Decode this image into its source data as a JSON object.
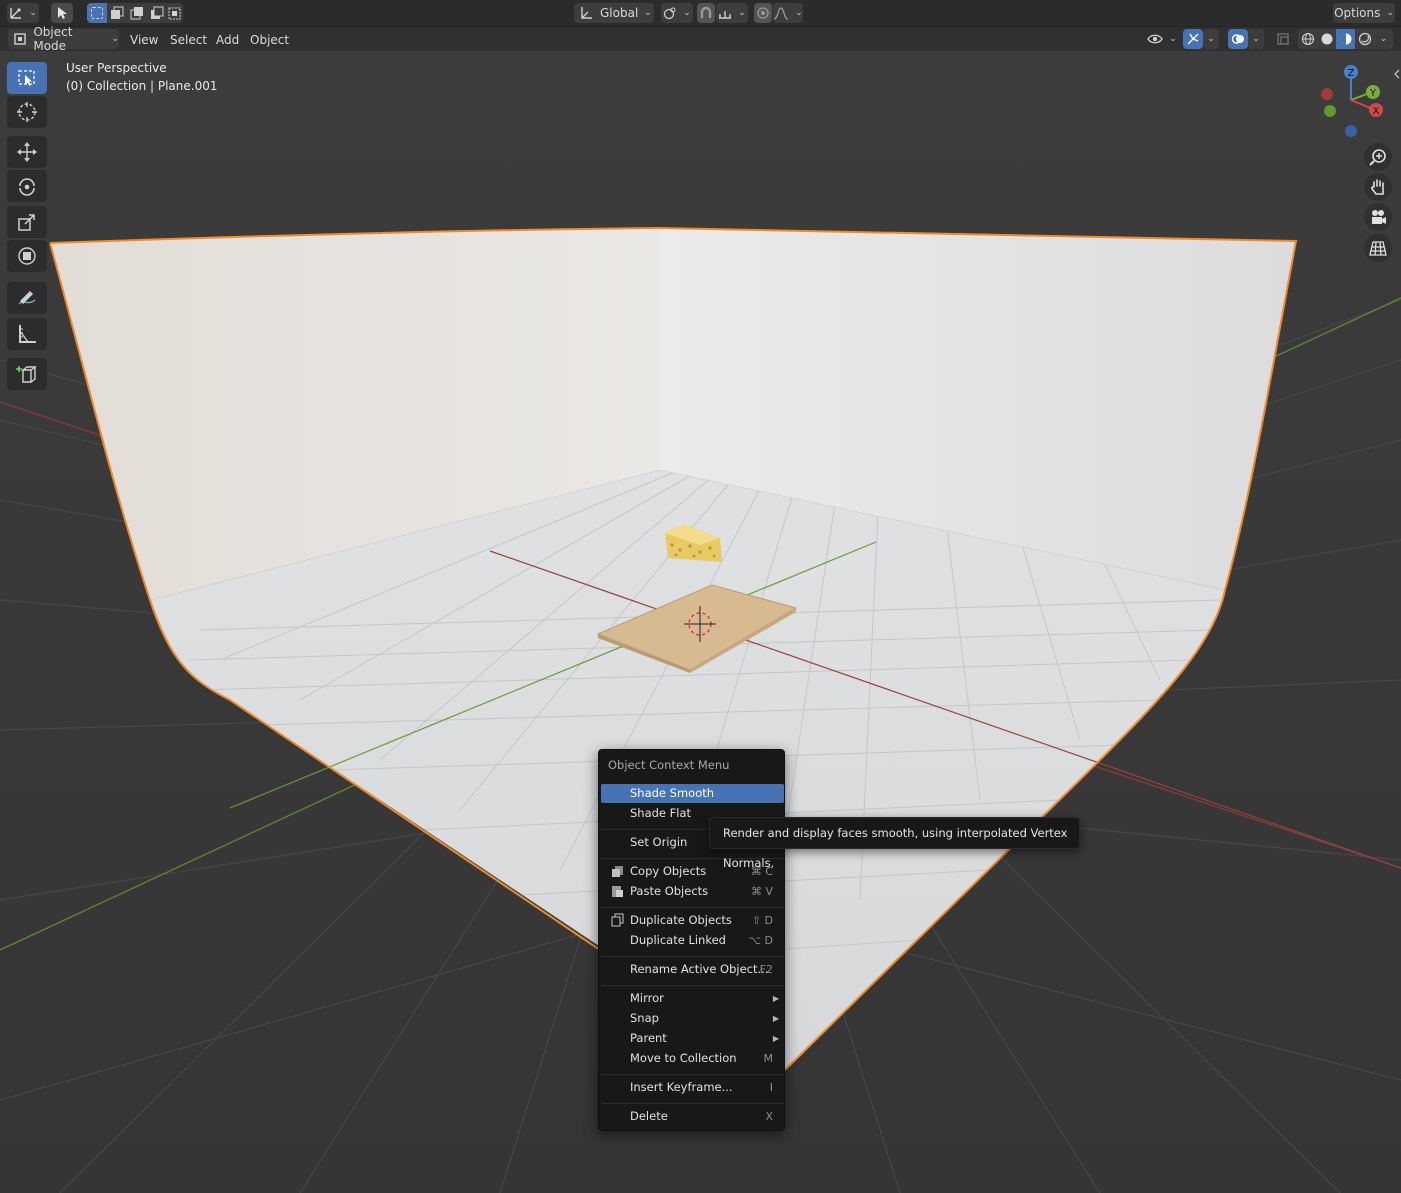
{
  "header": {
    "options_label": "Options",
    "transform_orientation": "Global",
    "mode_label": "Object Mode",
    "menus": [
      "View",
      "Select",
      "Add",
      "Object"
    ]
  },
  "viewport": {
    "view_name": "User Perspective",
    "collection_info": "(0) Collection | Plane.001",
    "gizmo": {
      "x": "X",
      "y": "Y",
      "z": "Z"
    }
  },
  "context_menu": {
    "title": "Object Context Menu",
    "items": [
      {
        "label": "Shade Smooth",
        "shortcut": ""
      },
      {
        "label": "Shade Flat",
        "shortcut": ""
      },
      {
        "label": "Set Origin",
        "shortcut": ""
      },
      {
        "label": "Copy Objects",
        "shortcut": "⌘ C"
      },
      {
        "label": "Paste Objects",
        "shortcut": "⌘ V"
      },
      {
        "label": "Duplicate Objects",
        "shortcut": "⇧ D"
      },
      {
        "label": "Duplicate Linked",
        "shortcut": "⌥ D"
      },
      {
        "label": "Rename Active Object...",
        "shortcut": "F2"
      },
      {
        "label": "Mirror",
        "shortcut": ""
      },
      {
        "label": "Snap",
        "shortcut": ""
      },
      {
        "label": "Parent",
        "shortcut": ""
      },
      {
        "label": "Move to Collection",
        "shortcut": "M"
      },
      {
        "label": "Insert Keyframe...",
        "shortcut": "I"
      },
      {
        "label": "Delete",
        "shortcut": "X"
      }
    ],
    "highlighted_index": 0
  },
  "tooltip": {
    "text": "Render and display faces smooth, using interpolated Vertex Normals."
  },
  "colors": {
    "accent": "#4772b3",
    "selection_outline": "#f08a2a",
    "x_axis": "#a23a3a",
    "y_axis": "#6a9a3a",
    "backdrop": "#e3e3e3"
  }
}
